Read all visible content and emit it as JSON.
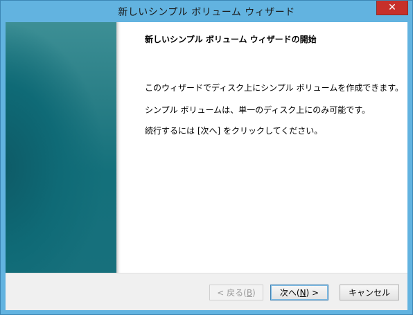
{
  "window": {
    "title": "新しいシンプル ボリューム ウィザード",
    "close_glyph": "✕"
  },
  "content": {
    "heading": "新しいシンプル ボリューム ウィザードの開始",
    "paragraphs": [
      "このウィザードでディスク上にシンプル ボリュームを作成できます。",
      "シンプル ボリュームは、単一のディスク上にのみ可能です。",
      "続行するには [次へ] をクリックしてください。"
    ]
  },
  "buttons": {
    "back": {
      "prefix": "< 戻る(",
      "mnemonic": "B",
      "suffix": ")"
    },
    "next": {
      "prefix": "次へ(",
      "mnemonic": "N",
      "suffix": ") >"
    },
    "cancel": "キャンセル"
  },
  "colors": {
    "titlebar": "#62b3e0",
    "close_button": "#c7302a",
    "banner": "#17707c"
  }
}
